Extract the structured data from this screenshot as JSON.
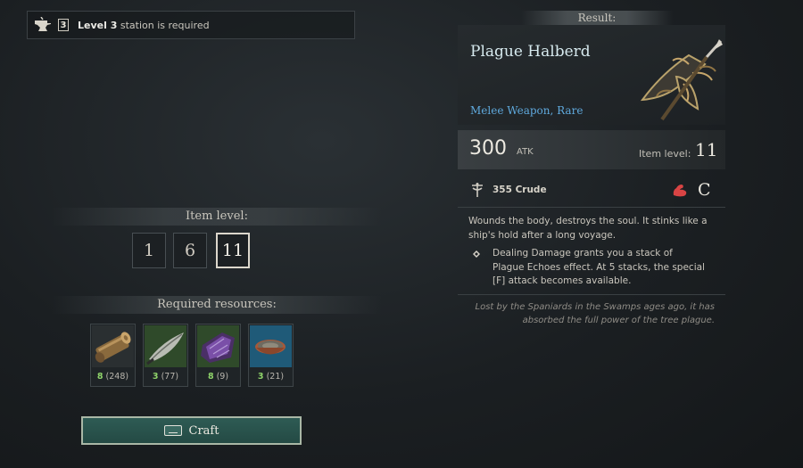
{
  "station": {
    "level_badge": "3",
    "level_text": "Level 3",
    "suffix": " station is required"
  },
  "item_level": {
    "heading": "Item level:",
    "options": [
      "1",
      "6",
      "11"
    ],
    "selected": "11"
  },
  "resources": {
    "heading": "Required resources:",
    "items": [
      {
        "icon": "wood-log-icon",
        "required": "8",
        "owned": "(248)"
      },
      {
        "icon": "leaf-bundle-icon",
        "required": "3",
        "owned": "(77)"
      },
      {
        "icon": "purple-crystal-icon",
        "required": "8",
        "owned": "(9)"
      },
      {
        "icon": "bowl-icon",
        "required": "3",
        "owned": "(21)"
      }
    ]
  },
  "craft_button": {
    "label": "Craft",
    "key_icon": "spacebar-key-icon"
  },
  "result": {
    "heading": "Result:",
    "name": "Plague Halberd",
    "type": "Melee Weapon, Rare",
    "atk_value": "300",
    "atk_unit": "ATK",
    "item_level_label": "Item level:",
    "item_level_value": "11",
    "material": "355 Crude",
    "grade": "C",
    "description": "Wounds the body, destroys the soul. It stinks like a ship's hold after a long voyage.",
    "effect": "Dealing Damage grants you a stack of Plague Echoes effect. At 5 stacks, the special [F] attack becomes available.",
    "lore": "Lost by the Spaniards in the Swamps ages ago, it has absorbed the full power of the tree plague."
  },
  "colors": {
    "accent_blue": "#5fa9dd",
    "resource_ok": "#8fd46a",
    "craft_green": "#2e5b54",
    "requirement_red": "#d94444"
  }
}
